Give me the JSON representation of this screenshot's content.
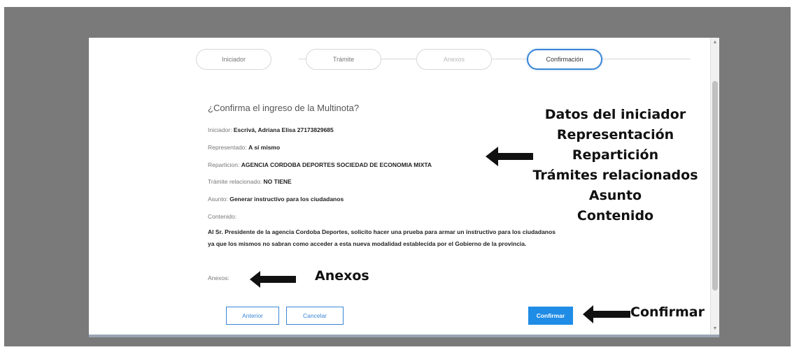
{
  "steps": [
    {
      "label": "Iniciador",
      "state": "done"
    },
    {
      "label": "Trámite",
      "state": "done"
    },
    {
      "label": "Anexos",
      "state": "disabled"
    },
    {
      "label": "Confirmación",
      "state": "active"
    }
  ],
  "title": "¿Confirma el ingreso de la Multinota?",
  "fields": {
    "iniciador": {
      "label": "Iniciador:",
      "value": "Escrivá, Adriana Elisa 27173829685"
    },
    "representado": {
      "label": "Representado:",
      "value": "A sí mismo"
    },
    "reparticion": {
      "label": "Reparticion:",
      "value": "AGENCIA CORDOBA DEPORTES SOCIEDAD DE ECONOMIA MIXTA"
    },
    "tramite": {
      "label": "Trámite relacionado:",
      "value": "NO TIENE"
    },
    "asunto": {
      "label": "Asunto:",
      "value": "Generar instructivo para los ciudadanos"
    },
    "contenido": {
      "label": "Contenido:"
    },
    "anexos": {
      "label": "Anexos:"
    }
  },
  "content_text": {
    "line1": "Al Sr. Presidente de la agencia Cordoba Deportes, solicito hacer una prueba para armar un instructivo para los ciudadanos",
    "line2": "ya que los mismos no sabran como acceder a esta nueva modalidad establecida por el Gobierno de la provincia."
  },
  "buttons": {
    "anterior": "Anterior",
    "cancelar": "Cancelar",
    "confirmar": "Confirmar"
  },
  "annotations": {
    "list": [
      "Datos del iniciador",
      "Representación",
      "Repartición",
      "Trámites relacionados",
      "Asunto",
      "Contenido"
    ],
    "anexos": "Anexos",
    "confirmar": "Confirmar"
  },
  "colors": {
    "accent": "#1f8ce6",
    "outline": "#3a86d4",
    "backdrop": "#7a7a7a"
  }
}
